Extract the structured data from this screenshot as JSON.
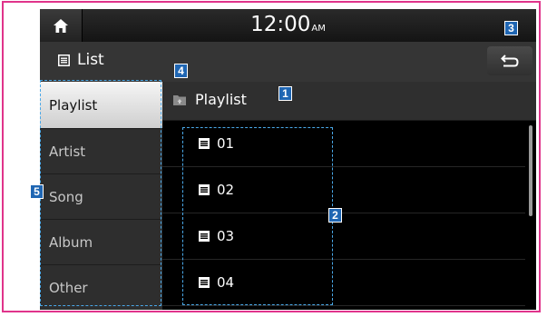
{
  "status": {
    "time": "12:00",
    "ampm": "AM"
  },
  "header": {
    "title": "List"
  },
  "sidebar": {
    "items": [
      {
        "label": "Playlist"
      },
      {
        "label": "Artist"
      },
      {
        "label": "Song"
      },
      {
        "label": "Album"
      },
      {
        "label": "Other"
      }
    ]
  },
  "folder": {
    "label": "Playlist"
  },
  "list": {
    "items": [
      {
        "label": "01"
      },
      {
        "label": "02"
      },
      {
        "label": "03"
      },
      {
        "label": "04"
      }
    ]
  },
  "callouts": {
    "c1": "1",
    "c2": "2",
    "c3": "3",
    "c4": "4",
    "c5": "5"
  },
  "icons": {
    "home": "home-icon",
    "list": "list-icon",
    "back": "back-arrow-icon",
    "folder": "folder-icon"
  },
  "colors": {
    "frame": "#e0348b",
    "callout": "#1f66b3",
    "outline": "#4aa8e8"
  }
}
